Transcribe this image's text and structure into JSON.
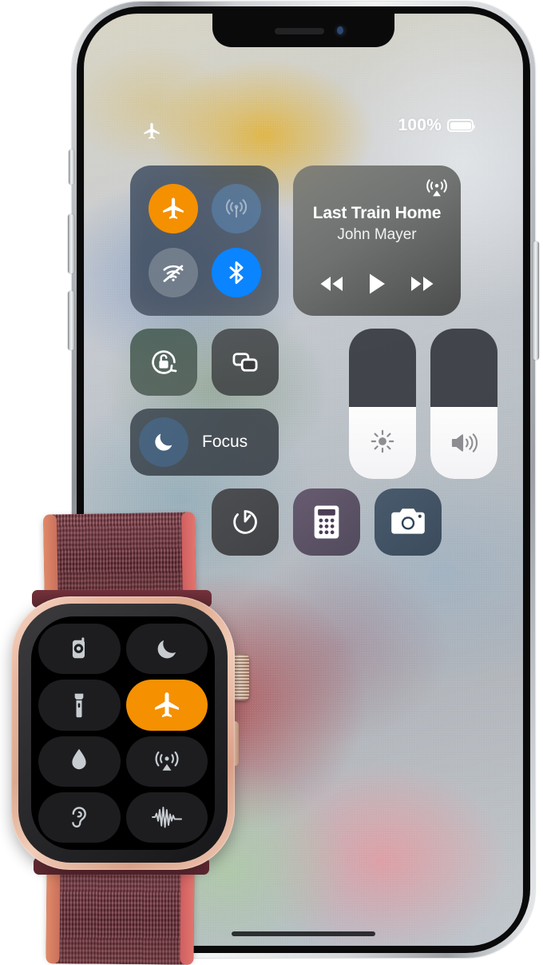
{
  "phone": {
    "status_bar": {
      "airplane_icon": "airplane-icon",
      "battery_percent": "100%",
      "battery_level": 100
    },
    "control_center": {
      "connectivity": {
        "buttons": [
          {
            "name": "airplane-mode",
            "icon": "airplane-icon",
            "state": "on",
            "color": "#f59000"
          },
          {
            "name": "cellular-data",
            "icon": "cellular-antenna-icon",
            "state": "dim",
            "color": "#5c8cbe"
          },
          {
            "name": "wifi",
            "icon": "wifi-off-icon",
            "state": "off",
            "color": "#bec3c8"
          },
          {
            "name": "bluetooth",
            "icon": "bluetooth-icon",
            "state": "on",
            "color": "#0a84ff"
          }
        ]
      },
      "media": {
        "airplay_icon": "airplay-audio-icon",
        "track_title": "Last Train Home",
        "track_artist": "John Mayer",
        "controls": [
          {
            "name": "previous-track",
            "icon": "rewind-icon"
          },
          {
            "name": "play",
            "icon": "play-icon"
          },
          {
            "name": "next-track",
            "icon": "fast-forward-icon"
          }
        ]
      },
      "rotation_lock": {
        "icon": "rotation-lock-icon",
        "state": "off"
      },
      "screen_mirroring": {
        "icon": "screen-mirroring-icon"
      },
      "focus": {
        "icon": "moon-icon",
        "label": "Focus"
      },
      "brightness_slider": {
        "icon": "brightness-icon",
        "value": 48
      },
      "volume_slider": {
        "icon": "speaker-icon",
        "value": 48
      },
      "shortcuts": [
        {
          "name": "timer",
          "icon": "timer-icon"
        },
        {
          "name": "calculator",
          "icon": "calculator-icon"
        },
        {
          "name": "camera",
          "icon": "camera-icon"
        }
      ]
    }
  },
  "watch": {
    "control_center": {
      "tiles": [
        {
          "name": "walkie-talkie",
          "icon": "walkie-talkie-icon",
          "state": "off"
        },
        {
          "name": "theater-mode",
          "icon": "moon-icon",
          "state": "off"
        },
        {
          "name": "flashlight",
          "icon": "flashlight-icon",
          "state": "off"
        },
        {
          "name": "airplane-mode",
          "icon": "airplane-icon",
          "state": "on"
        },
        {
          "name": "water-lock",
          "icon": "water-drop-icon",
          "state": "off"
        },
        {
          "name": "airplay",
          "icon": "airplay-audio-icon",
          "state": "off"
        },
        {
          "name": "live-listen",
          "icon": "ear-icon",
          "state": "off"
        },
        {
          "name": "noise-level",
          "icon": "waveform-icon",
          "state": "off"
        }
      ],
      "accent_color": "#f59000"
    }
  }
}
